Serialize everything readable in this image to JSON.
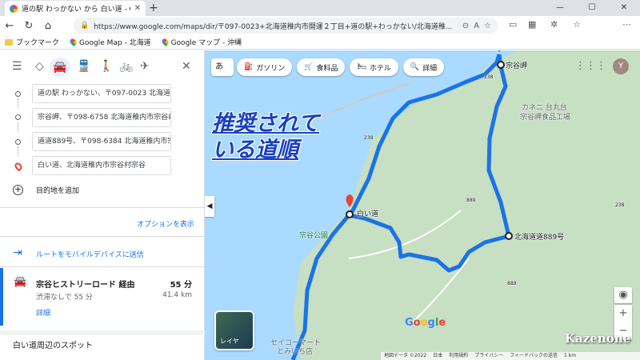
{
  "browser": {
    "tab_title": "道の駅 わっかない から 白い道 - Goo",
    "url": "https://www.google.com/maps/dir/〒097-0023+北海道稚内市開運２丁目+道の駅+わっかない/北海道稚...",
    "bookmarks": [
      "ブックマーク",
      "Google Map - 北海道",
      "Google マップ - 沖縄"
    ]
  },
  "sidebar": {
    "stops": [
      "道の駅 わっかない、〒097-0023 北海道稚内",
      "宗谷岬、〒098-6758 北海道稚内市宗谷岬",
      "道道889号、〒098-6384 北海道稚内市宗谷",
      "白い道、北海道稚内市宗谷村宗谷"
    ],
    "add_destination": "目的地を追加",
    "options": "オプションを表示",
    "send_to_device": "ルートをモバイルデバイスに送信",
    "route": {
      "name": "宗谷ヒストリーロード 経由",
      "time": "55 分",
      "sub": "渋滞なしで 55 分",
      "distance": "41.4 km",
      "details": "詳細"
    },
    "nearby": "白い道周辺のスポット"
  },
  "map": {
    "lang_button": "あ",
    "chips": [
      {
        "icon": "fuel-icon",
        "label": "ガソリン"
      },
      {
        "icon": "cart-icon",
        "label": "食料品"
      },
      {
        "icon": "bed-icon",
        "label": "ホテル"
      },
      {
        "icon": "search-icon",
        "label": "詳細"
      }
    ],
    "account_initial": "Y",
    "overlay_line1": "推奨されて",
    "overlay_line2": "いる道順",
    "labels": {
      "soya_misaki": "宗谷岬",
      "shiroi_michi": "白い道",
      "road889": "北海道道889号",
      "soya_park": "宗谷公園",
      "kaneni": "カネニ 台丸台",
      "kaneni2": "宗谷岬食品工場",
      "seiko": "セイコーマート",
      "seiko2": "とみいち店"
    },
    "road_numbers": [
      "238",
      "238",
      "238",
      "889",
      "889"
    ],
    "layer_label": "レイヤ",
    "google": "Google",
    "watermark": "Kazenone",
    "footer": [
      "地図データ ©2022",
      "日本",
      "利用規約",
      "プライバシー",
      "フィードバックの送信",
      "1 km"
    ],
    "colors": {
      "route": "#1a73e8",
      "land": "#c7dfc3",
      "water": "#aadaff"
    }
  }
}
